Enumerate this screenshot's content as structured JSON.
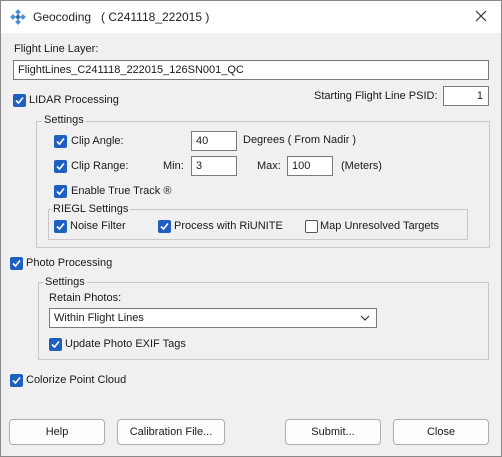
{
  "window": {
    "title": "Geocoding",
    "subtitle": "( C241118_222015 )"
  },
  "flight_line_layer": {
    "label": "Flight Line Layer:",
    "value": "FlightLines_C241118_222015_126SN001_QC"
  },
  "lidar": {
    "label": "LIDAR Processing",
    "checked": true,
    "starting_psid_label": "Starting Flight Line PSID:",
    "starting_psid_value": "1",
    "settings": {
      "legend": "Settings",
      "clip_angle": {
        "label": "Clip Angle:",
        "checked": true,
        "value": "40",
        "units": "Degrees ( From Nadir )"
      },
      "clip_range": {
        "label": "Clip Range:",
        "checked": true,
        "min_label": "Min:",
        "min_value": "3",
        "max_label": "Max:",
        "max_value": "100",
        "units": "(Meters)"
      },
      "enable_true_track": {
        "label": "Enable True Track ®",
        "checked": true
      },
      "riegl": {
        "legend": "RIEGL Settings",
        "noise_filter": {
          "label": "Noise Filter",
          "checked": true
        },
        "process_riunite": {
          "label": "Process with RiUNITE",
          "checked": true
        },
        "map_unresolved": {
          "label": "Map Unresolved Targets",
          "checked": false
        }
      }
    }
  },
  "photo": {
    "label": "Photo Processing",
    "checked": true,
    "settings": {
      "legend": "Settings",
      "retain_label": "Retain Photos:",
      "retain_value": "Within Flight Lines",
      "update_exif": {
        "label": "Update Photo EXIF Tags",
        "checked": true
      }
    }
  },
  "colorize": {
    "label": "Colorize Point Cloud",
    "checked": true
  },
  "buttons": {
    "help": "Help",
    "calibration": "Calibration File...",
    "submit": "Submit...",
    "close": "Close"
  },
  "colors": {
    "accent": "#1f5fbf",
    "window_bg": "#f0f0f0"
  }
}
